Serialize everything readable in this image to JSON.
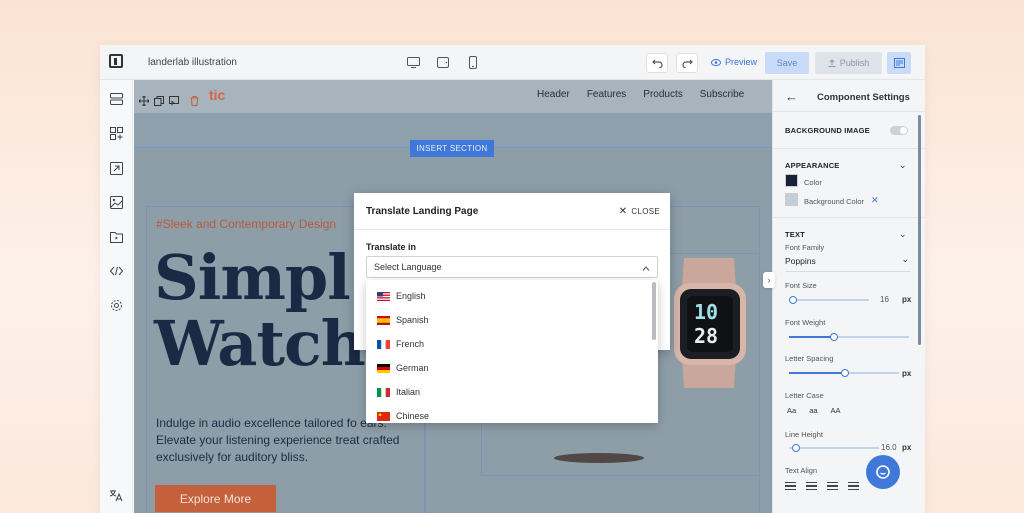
{
  "topbar": {
    "project_title": "landerlab illustration",
    "preview_label": "Preview",
    "save_label": "Save",
    "publish_label": "Publish"
  },
  "site": {
    "logo_text": "tic",
    "nav": [
      "Header",
      "Features",
      "Products",
      "Subscribe"
    ],
    "insert_section_label": "INSERT SECTION",
    "tagline": "#Sleek and Contemporary Design",
    "title_line1": "Simpl",
    "title_line2": "Watch",
    "hero_text": "Indulge in audio excellence tailored fo ears. Elevate your listening experience treat crafted exclusively for auditory bliss.",
    "cta_label": "Explore More",
    "watch_time_top": "10",
    "watch_time_bottom": "28"
  },
  "modal": {
    "title": "Translate Landing Page",
    "close_label": "CLOSE",
    "translate_label": "Translate in",
    "select_value": "Select Language",
    "languages": [
      "English",
      "Spanish",
      "French",
      "German",
      "Italian",
      "Chinese"
    ]
  },
  "settings": {
    "title": "Component Settings",
    "background_image_label": "BACKGROUND IMAGE",
    "appearance_label": "APPEARANCE",
    "color_label": "Color",
    "color_value": "#16213a",
    "background_color_label": "Background Color",
    "background_color_value": "#c3ced6",
    "text_label": "TEXT",
    "font_family_label": "Font Family",
    "font_family_value": "Poppins",
    "font_size_label": "Font Size",
    "font_size_value": "16",
    "font_size_unit": "px",
    "font_weight_label": "Font Weight",
    "letter_spacing_label": "Letter Spacing",
    "letter_spacing_unit": "px",
    "letter_case_label": "Letter Case",
    "letter_case_options": [
      "Aa",
      "aa",
      "AA"
    ],
    "line_height_label": "Line Height",
    "line_height_value": "16.0",
    "line_height_unit": "px",
    "text_align_label": "Text Align"
  },
  "colors": {
    "accent": "#3f78d8",
    "brand_orange": "#c5603c",
    "title_navy": "#1b2a44"
  }
}
